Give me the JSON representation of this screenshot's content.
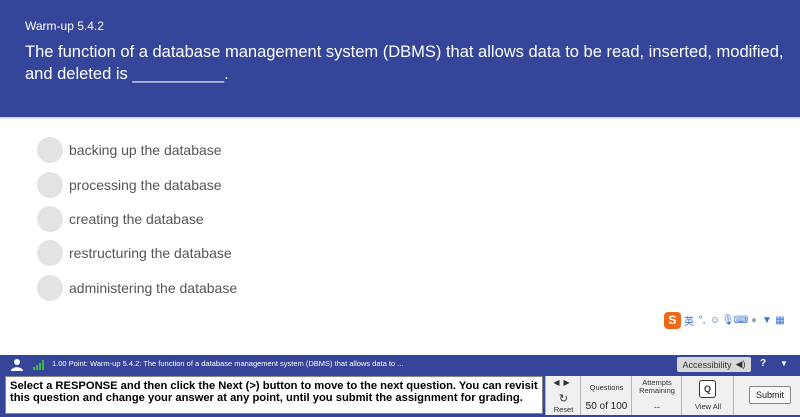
{
  "header": {
    "label": "Warm-up 5.4.2",
    "question": "The function of a database management system (DBMS) that allows data to be read, inserted, modified, and deleted is __________."
  },
  "options": [
    {
      "label": "backing up the database"
    },
    {
      "label": "processing the database"
    },
    {
      "label": "creating the database"
    },
    {
      "label": "restructuring the database"
    },
    {
      "label": "administering the database"
    }
  ],
  "ime_toolbar": {
    "logo": "S",
    "mode": "英",
    "icons": [
      "punctuation-icon",
      "emoji-icon",
      "microphone-icon",
      "keyboard-icon",
      "user-icon",
      "shirt-icon",
      "grid-icon"
    ]
  },
  "status_bar": {
    "text": "1.00 Point: Warm-up 5.4.2: The function of a database management system (DBMS) that allows data to ...",
    "accessibility_label": "Accessibility",
    "help_label": "?",
    "collapse_label": "▼"
  },
  "footer": {
    "instruction": "Select a RESPONSE and then click the Next (>) button to move to the next question. You can revisit this question and change your answer at any point, until you submit the assignment for grading.",
    "prev_arrow": "◀",
    "next_arrow": "▶",
    "reset_label": "Reset",
    "questions_label": "Questions",
    "questions_count": "50 of 100",
    "attempts_label": "Attempts Remaining",
    "attempts_value": "--",
    "view_all_label": "View All",
    "submit_label": "Submit"
  },
  "colors": {
    "header_bg": "#354599",
    "radio_bg": "#e3e3e3",
    "signal_green": "#3dbb3d",
    "ime_orange": "#ec6a1a"
  }
}
